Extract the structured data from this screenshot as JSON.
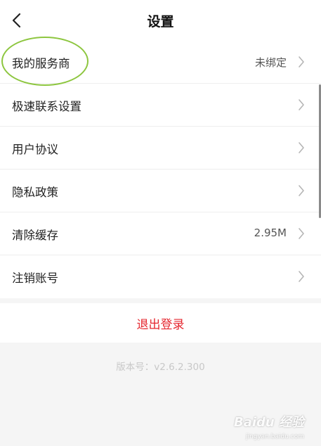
{
  "header": {
    "title": "设置",
    "back_icon": "chevron-left-icon"
  },
  "settings": {
    "items": [
      {
        "label": "我的服务商",
        "value": "未绑定"
      },
      {
        "label": "极速联系设置",
        "value": ""
      },
      {
        "label": "用户协议",
        "value": ""
      },
      {
        "label": "隐私政策",
        "value": ""
      },
      {
        "label": "清除缓存",
        "value": "2.95M"
      },
      {
        "label": "注销账号",
        "value": ""
      }
    ]
  },
  "logout": {
    "label": "退出登录",
    "color": "#e5272f"
  },
  "version": {
    "text": "版本号：v2.6.2.300"
  },
  "watermark": {
    "text": "Baidu 经验",
    "sub": "jingyan.baidu.com"
  },
  "colors": {
    "highlight_ring": "#8dc63f",
    "background": "#f5f5f5"
  }
}
